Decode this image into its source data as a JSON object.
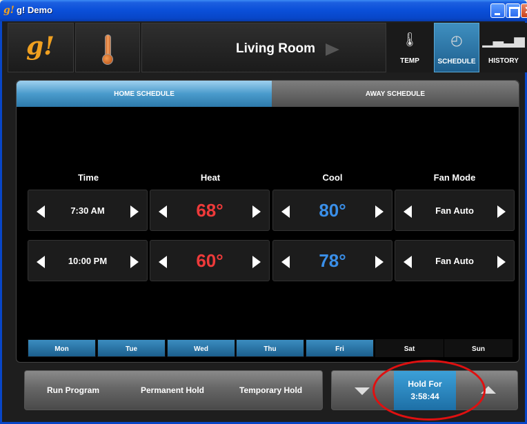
{
  "window": {
    "title": "g! Demo",
    "icon_name": "g-app-icon"
  },
  "header": {
    "logo_text": "g!",
    "room_name": "Living Room",
    "nav": [
      {
        "label": "TEMP",
        "icon": "thermometer-icon",
        "active": false
      },
      {
        "label": "SCHEDULE",
        "icon": "clock-icon",
        "active": true
      },
      {
        "label": "HISTORY",
        "icon": "bar-chart-icon",
        "active": false
      }
    ]
  },
  "tabs": {
    "home": "HOME SCHEDULE",
    "away": "AWAY SCHEDULE",
    "active": "home"
  },
  "columns": {
    "time": "Time",
    "heat": "Heat",
    "cool": "Cool",
    "fan": "Fan Mode"
  },
  "rows": [
    {
      "time": "7:30 AM",
      "heat": "68°",
      "cool": "80°",
      "fan": "Fan Auto"
    },
    {
      "time": "10:00 PM",
      "heat": "60°",
      "cool": "78°",
      "fan": "Fan Auto"
    }
  ],
  "days": [
    {
      "label": "Mon",
      "selected": true
    },
    {
      "label": "Tue",
      "selected": true
    },
    {
      "label": "Wed",
      "selected": true
    },
    {
      "label": "Thu",
      "selected": true
    },
    {
      "label": "Fri",
      "selected": true
    },
    {
      "label": "Sat",
      "selected": false
    },
    {
      "label": "Sun",
      "selected": false
    }
  ],
  "controls": {
    "run_program": "Run Program",
    "permanent_hold": "Permanent Hold",
    "temporary_hold": "Temporary Hold",
    "hold_for_label": "Hold For",
    "hold_for_value": "3:58:44"
  },
  "colors": {
    "heat": "#ee3a3a",
    "cool": "#3a8fe8",
    "accent": "#2d7aab",
    "brand": "#f0a020"
  }
}
